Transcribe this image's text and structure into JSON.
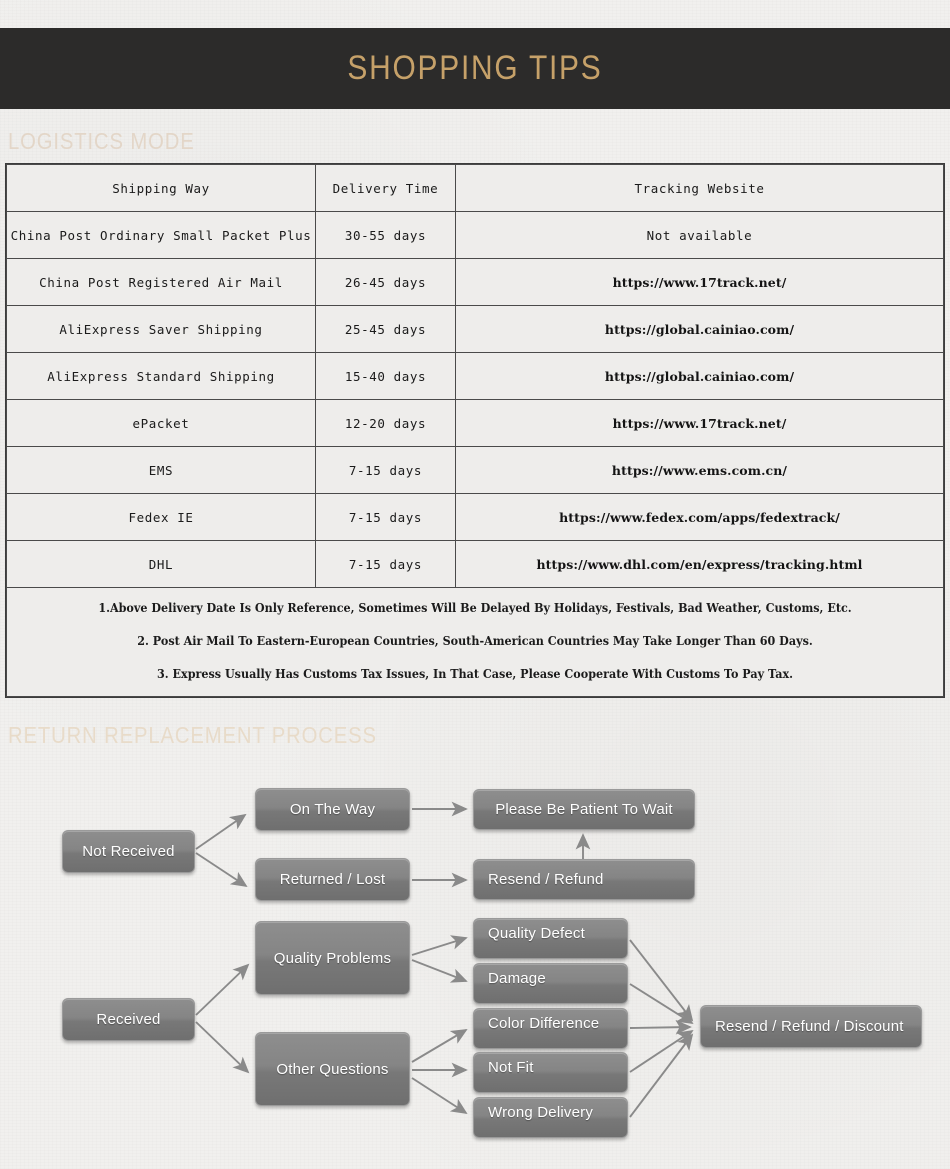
{
  "banner": {
    "title": "SHOPPING TIPS"
  },
  "sections": {
    "logistics": {
      "heading": "LOGISTICS MODE"
    },
    "return": {
      "heading": "RETURN REPLACEMENT PROCESS"
    }
  },
  "logistics_table": {
    "columns": [
      "Shipping Way",
      "Delivery Time",
      "Tracking Website"
    ],
    "rows": [
      {
        "way": "China Post Ordinary Small Packet Plus",
        "time": "30-55 days",
        "site": "Not available",
        "site_style": "mono"
      },
      {
        "way": "China Post Registered Air Mail",
        "time": "26-45 days",
        "site": "https://www.17track.net/",
        "site_style": "url"
      },
      {
        "way": "AliExpress Saver Shipping",
        "time": "25-45 days",
        "site": "https://global.cainiao.com/",
        "site_style": "url"
      },
      {
        "way": "AliExpress Standard Shipping",
        "time": "15-40 days",
        "site": "https://global.cainiao.com/",
        "site_style": "url"
      },
      {
        "way": "ePacket",
        "time": "12-20 days",
        "site": "https://www.17track.net/",
        "site_style": "url"
      },
      {
        "way": "EMS",
        "time": "7-15 days",
        "site": "https://www.ems.com.cn/",
        "site_style": "url"
      },
      {
        "way": "Fedex IE",
        "time": "7-15 days",
        "site": "https://www.fedex.com/apps/fedextrack/",
        "site_style": "url"
      },
      {
        "way": "DHL",
        "time": "7-15 days",
        "site": "https://www.dhl.com/en/express/tracking.html",
        "site_style": "url"
      }
    ],
    "notes": [
      "1.Above Delivery Date Is Only Reference, Sometimes Will Be Delayed By Holidays, Festivals, Bad Weather, Customs, Etc.",
      "2. Post Air Mail To Eastern-European Countries, South-American Countries May Take Longer Than 60 Days.",
      "3. Express Usually Has Customs Tax Issues, In That Case, Please Cooperate With Customs To Pay Tax."
    ]
  },
  "flowchart": {
    "nodes": {
      "not_received": "Not Received",
      "on_the_way": "On The Way",
      "returned_lost": "Returned / Lost",
      "please_wait": "Please Be Patient To Wait",
      "resend_refund": "Resend / Refund",
      "received": "Received",
      "quality_problems": "Quality Problems",
      "other_questions": "Other Questions",
      "quality_defect": "Quality Defect",
      "damage": "Damage",
      "color_difference": "Color Difference",
      "not_fit": "Not Fit",
      "wrong_delivery": "Wrong Delivery",
      "resend_refund_discount": "Resend / Refund / Discount"
    }
  },
  "colors": {
    "banner_bg": "#2c2b2a",
    "banner_title": "#c6a169",
    "section_heading": "#e3d6c8",
    "page_bg": "#f1f0ee",
    "box_fill": "#858585",
    "arrow": "#8a8a8a",
    "table_border": "#4a4a4a"
  }
}
